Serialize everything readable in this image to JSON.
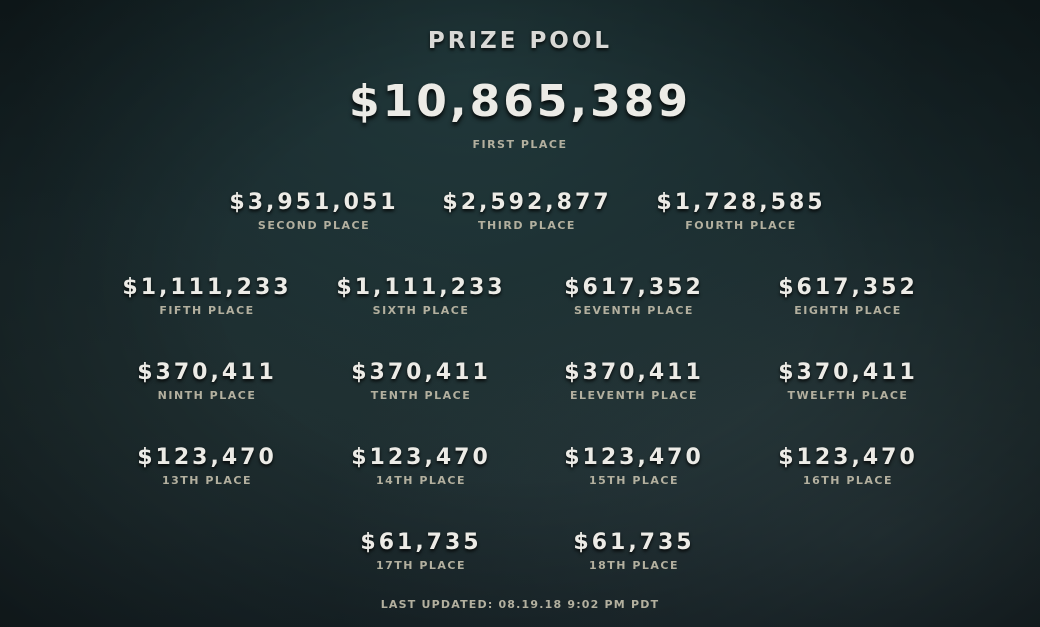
{
  "header": {
    "title": "PRIZE POOL"
  },
  "first": {
    "amount": "$10,865,389",
    "label": "FIRST PLACE"
  },
  "prizes": [
    {
      "amount": "$3,951,051",
      "label": "SECOND PLACE"
    },
    {
      "amount": "$2,592,877",
      "label": "THIRD PLACE"
    },
    {
      "amount": "$1,728,585",
      "label": "FOURTH PLACE"
    },
    {
      "amount": "$1,111,233",
      "label": "FIFTH PLACE"
    },
    {
      "amount": "$1,111,233",
      "label": "SIXTH PLACE"
    },
    {
      "amount": "$617,352",
      "label": "SEVENTH PLACE"
    },
    {
      "amount": "$617,352",
      "label": "EIGHTH PLACE"
    },
    {
      "amount": "$370,411",
      "label": "NINTH PLACE"
    },
    {
      "amount": "$370,411",
      "label": "TENTH PLACE"
    },
    {
      "amount": "$370,411",
      "label": "ELEVENTH PLACE"
    },
    {
      "amount": "$370,411",
      "label": "TWELFTH PLACE"
    },
    {
      "amount": "$123,470",
      "label": "13TH PLACE"
    },
    {
      "amount": "$123,470",
      "label": "14TH PLACE"
    },
    {
      "amount": "$123,470",
      "label": "15TH PLACE"
    },
    {
      "amount": "$123,470",
      "label": "16TH PLACE"
    },
    {
      "amount": "$61,735",
      "label": "17TH PLACE"
    },
    {
      "amount": "$61,735",
      "label": "18TH PLACE"
    }
  ],
  "footer": {
    "last_updated": "LAST UPDATED: 08.19.18 9:02 PM PDT"
  },
  "colors": {
    "amount_text": "#ecebe6",
    "label_text": "#b3b09f",
    "background": "#1a2a2d"
  }
}
